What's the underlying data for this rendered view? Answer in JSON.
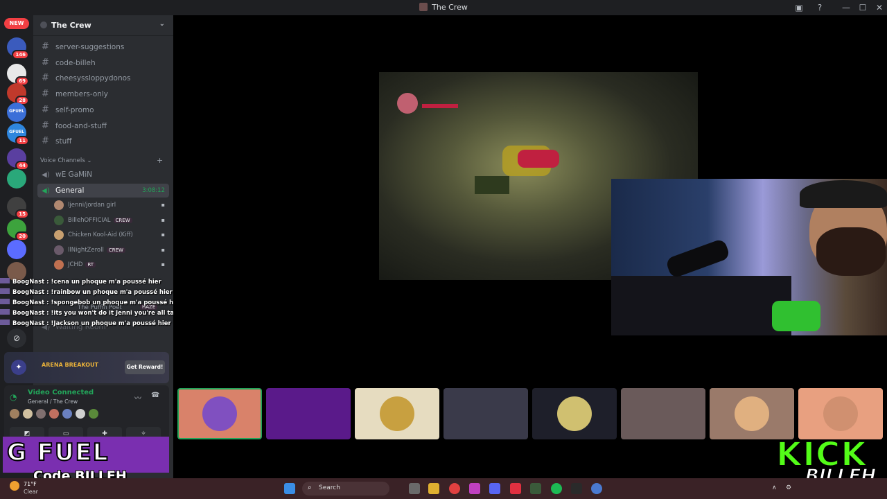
{
  "window": {
    "title": "The Crew",
    "controls": [
      "—",
      "☐",
      "✕"
    ]
  },
  "guilds": {
    "new_label": "NEW",
    "items": [
      {
        "badge": "146",
        "color": "#3b5bbd"
      },
      {
        "badge": "69",
        "color": "#e8e8e8"
      },
      {
        "badge": "28",
        "color": "#c0392b"
      },
      {
        "badge": "",
        "color": "#3b6fd8",
        "text": "GFUEL"
      },
      {
        "badge": "11",
        "color": "#2e86de",
        "text": "GFUEL"
      },
      {
        "badge": "44",
        "color": "#5a3fa0"
      },
      {
        "badge": "",
        "color": "#2aa87a"
      },
      {
        "badge": "15",
        "color": "#404040"
      },
      {
        "badge": "20",
        "color": "#3da33d"
      },
      {
        "badge": "",
        "color": "#5b6cff"
      },
      {
        "badge": "",
        "color": "#7a5a4a"
      }
    ]
  },
  "server": {
    "name": "The Crew"
  },
  "channels": [
    {
      "name": "server-suggestions"
    },
    {
      "name": "code-billeh"
    },
    {
      "name": "cheesyssloppydonos"
    },
    {
      "name": "members-only"
    },
    {
      "name": "self-promo"
    },
    {
      "name": "food-and-stuff"
    },
    {
      "name": "stuff"
    }
  ],
  "voice": {
    "category": "Voice Channels",
    "channels": [
      {
        "name": "wE GaMiN"
      },
      {
        "name": "General",
        "time": "3:08:12"
      }
    ],
    "users": [
      {
        "name": "ljenni/jordan girl",
        "badge": "",
        "color": "#b08870"
      },
      {
        "name": "BillehOFFICIAL",
        "badge": "CREW",
        "color": "#3a5a3a"
      },
      {
        "name": "Chicken Kool-Aid (Kiff)",
        "badge": "",
        "color": "#c8a070"
      },
      {
        "name": "llNightZeroll",
        "badge": "CREW",
        "color": "#6a5a6a"
      },
      {
        "name": "JCHD",
        "badge": "RT",
        "color": "#c07050"
      }
    ],
    "waiting_room": "Waiting Room",
    "partial_user": "The Puffin Poet",
    "partial_badge": "HAZE"
  },
  "chat_overlay": [
    {
      "user": "BoogNast",
      "text": "!cena un phoque m'a poussé hier"
    },
    {
      "user": "BoogNast",
      "text": "!rainbow un phoque m'a poussé hier"
    },
    {
      "user": "BoogNast",
      "text": "!spongebob un phoque m'a poussé hier"
    },
    {
      "user": "BoogNast",
      "text": "!its you won't do it Jenni you're all talk"
    },
    {
      "user": "BoogNast",
      "text": "!Jackson un phoque m'a poussé hier"
    }
  ],
  "promo": {
    "logo": "ARENA BREAKOUT",
    "button": "Get Reward!"
  },
  "voice_panel": {
    "status": "Video Connected",
    "location": "General / The Crew",
    "avatar_colors": [
      "#a08060",
      "#d0c0a0",
      "#807070",
      "#c07060",
      "#6a80c0",
      "#d0d0d0",
      "#5a8a3a"
    ]
  },
  "gfuel": {
    "brand": "G FUEL",
    "code": "Code BILLEH"
  },
  "kick": {
    "brand": "KICK",
    "name": "BILLEH"
  },
  "weather": {
    "temp": "71°F",
    "cond": "Clear"
  },
  "taskbar": {
    "search_placeholder": "Search"
  },
  "tiles": [
    {
      "bg": "#d9826a",
      "av": "#8050c0",
      "selected": true
    },
    {
      "bg": "#5a1a8a",
      "av": "",
      "selected": false
    },
    {
      "bg": "#e6dcc0",
      "av": "#c8a040",
      "selected": false
    },
    {
      "bg": "#3a3a4a",
      "av": "",
      "selected": false
    },
    {
      "bg": "#1e1f2a",
      "av": "#d0c070",
      "selected": false
    },
    {
      "bg": "#6a5a5a",
      "av": "",
      "selected": false
    },
    {
      "bg": "#9a7a6a",
      "av": "#e0b080",
      "selected": false
    },
    {
      "bg": "#e8a080",
      "av": "#d09070",
      "selected": false
    }
  ]
}
